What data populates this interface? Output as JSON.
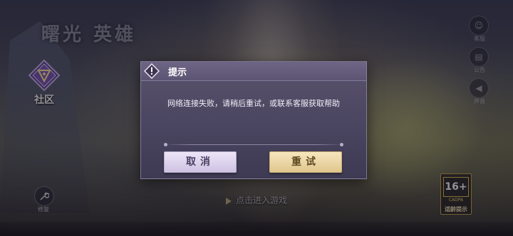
{
  "background": {
    "game_logo": "曙光 英雄"
  },
  "left_panel": {
    "community_label": "社区",
    "repair_label": "修复"
  },
  "right_panel": {
    "icons": [
      {
        "icon": "customer-service-icon",
        "label": "客服"
      },
      {
        "icon": "announcement-icon",
        "label": "公告"
      },
      {
        "icon": "speaker-icon",
        "label": "声音"
      }
    ]
  },
  "enter_hint": "点击进入游戏",
  "age_rating": {
    "value": "16+",
    "sub": "CADPA",
    "caption": "适龄提示"
  },
  "dialog": {
    "title": "提示",
    "message": "网络连接失败，请稍后重试，或联系客服获取帮助",
    "cancel_label": "取消",
    "retry_label": "重试"
  },
  "colors": {
    "dialog_bg": "#4a4560",
    "cancel_button": "#ded4ee",
    "retry_button": "#ebd6a5"
  }
}
